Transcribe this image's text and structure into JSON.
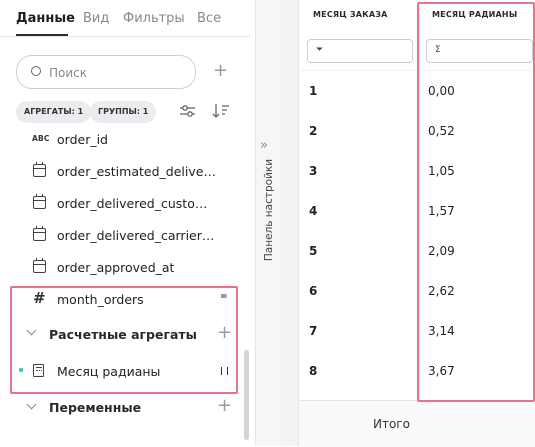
{
  "tabs": [
    {
      "label": "Данные",
      "active": true
    },
    {
      "label": "Вид",
      "active": false
    },
    {
      "label": "Фильтры",
      "active": false
    },
    {
      "label": "Все",
      "active": false
    }
  ],
  "search": {
    "placeholder": "Поиск",
    "value": ""
  },
  "chips": {
    "aggregates": "АГРЕГАТЫ: 1",
    "groups": "ГРУППЫ: 1"
  },
  "fields": [
    {
      "icon": "abc-icon",
      "icon_text": "ABC",
      "label": "order_id"
    },
    {
      "icon": "calendar-icon",
      "label": "order_estimated_delivery_date"
    },
    {
      "icon": "calendar-icon",
      "label": "order_delivered_customer_date"
    },
    {
      "icon": "calendar-icon",
      "label": "order_delivered_carrier_date"
    },
    {
      "icon": "calendar-icon",
      "label": "order_approved_at"
    }
  ],
  "measure_field": {
    "icon_text": "#",
    "label": "month_orders",
    "handle": "=",
    "highlighted": true
  },
  "calculated_section": {
    "label": "Расчетные агрегаты"
  },
  "calculated_item": {
    "label": "Месяц радианы",
    "indicator_color": "#4ec7c0"
  },
  "variables_section": {
    "label": "Переменные"
  },
  "settings_panel": {
    "label": "Панель настройки",
    "collapse_glyph": "»"
  },
  "table": {
    "columns": [
      {
        "header": "МЕСЯЦ ЗАКАЗА",
        "filter_glyph": "⏷"
      },
      {
        "header": "МЕСЯЦ РАДИАНЫ",
        "filter_glyph": "Σ"
      }
    ],
    "rows": [
      [
        "1",
        "0,00"
      ],
      [
        "2",
        "0,52"
      ],
      [
        "3",
        "1,05"
      ],
      [
        "4",
        "1,57"
      ],
      [
        "5",
        "2,09"
      ],
      [
        "6",
        "2,62"
      ],
      [
        "7",
        "3,14"
      ],
      [
        "8",
        "3,67"
      ]
    ],
    "total_label": "Итого"
  },
  "colors": {
    "highlight_border": "#e7738a",
    "accent_teal": "#4ec7c0"
  }
}
